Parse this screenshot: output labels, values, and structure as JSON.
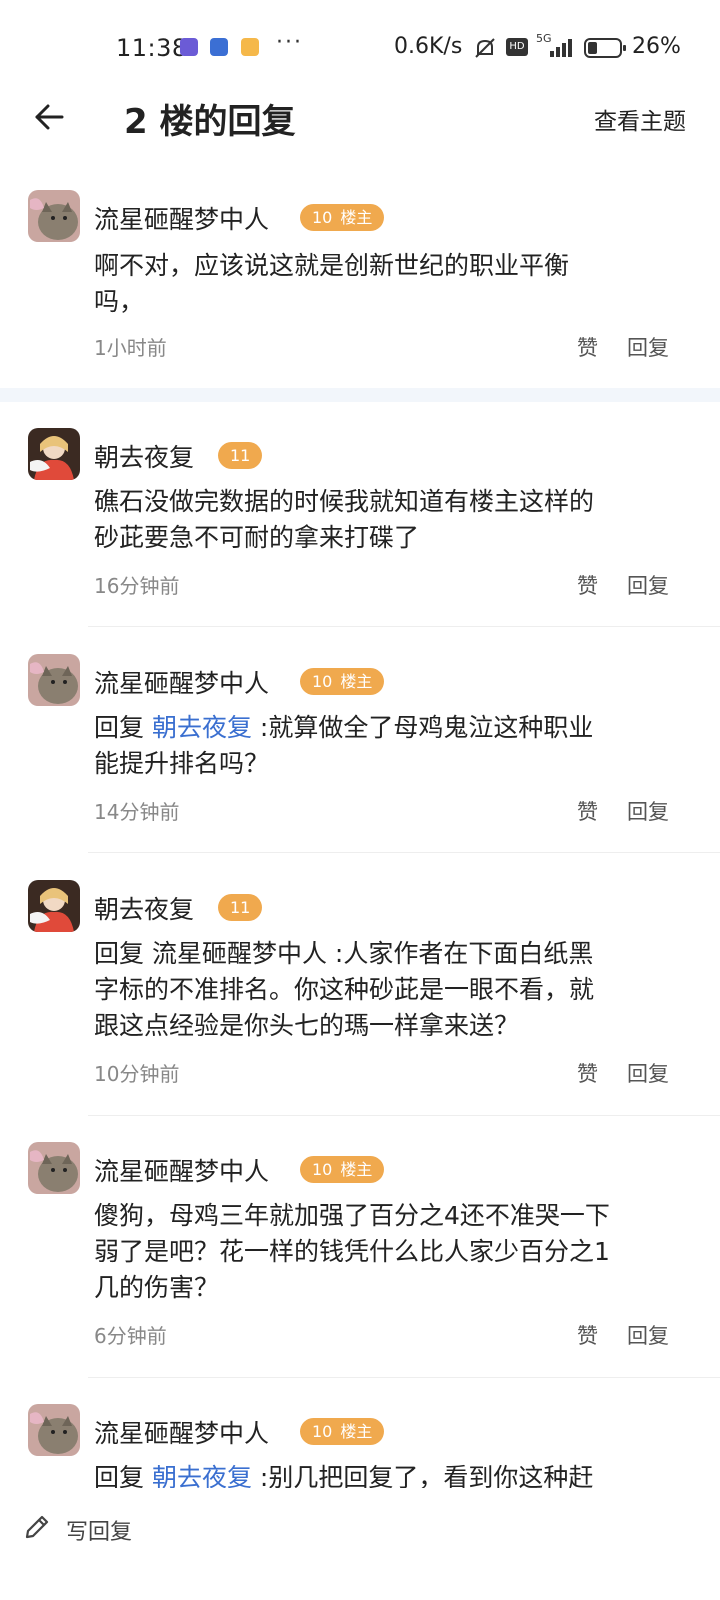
{
  "status_bar": {
    "time": "11:38",
    "dots": "···",
    "net_speed": "0.6K/s",
    "hd": "HD",
    "net_type": "5G",
    "battery": "26%"
  },
  "header": {
    "title": "2 楼的回复",
    "view_topic": "查看主题"
  },
  "comments": [
    {
      "user": "流星砸醒梦中人",
      "level": "10",
      "op_label": "楼主",
      "text_line1": "啊不对，应该说这就是创新世纪的职业平衡",
      "text_line2": "吗，",
      "time": "1小时前",
      "like": "赞",
      "reply": "回复"
    },
    {
      "user": "朝去夜复",
      "level": "11",
      "text_line1": "礁石没做完数据的时候我就知道有楼主这样的",
      "text_line2": "砂茈要急不可耐的拿来打碟了",
      "time": "16分钟前",
      "like": "赞",
      "reply": "回复"
    },
    {
      "user": "流星砸醒梦中人",
      "level": "10",
      "op_label": "楼主",
      "reply_prefix": "回复 ",
      "mention": "朝去夜复",
      "text_line1": " :就算做全了母鸡鬼泣这种职业",
      "text_line2": "能提升排名吗？",
      "time": "14分钟前",
      "like": "赞",
      "reply": "回复"
    },
    {
      "user": "朝去夜复",
      "level": "11",
      "text_line1": "回复 流星砸醒梦中人 :人家作者在下面白纸黑",
      "text_line2": "字标的不准排名。你这种砂茈是一眼不看，就",
      "text_line3": "跟这点经验是你头七的瑪一样拿来送？",
      "time": "10分钟前",
      "like": "赞",
      "reply": "回复"
    },
    {
      "user": "流星砸醒梦中人",
      "level": "10",
      "op_label": "楼主",
      "text_line1": "傻狗，母鸡三年就加强了百分之4还不准哭一下",
      "text_line2": "弱了是吧？花一样的钱凭什么比人家少百分之1",
      "text_line3": "几的伤害？",
      "time": "6分钟前",
      "like": "赞",
      "reply": "回复"
    },
    {
      "user": "流星砸醒梦中人",
      "level": "10",
      "op_label": "楼主",
      "reply_prefix": "回复 ",
      "mention": "朝去夜复",
      "text_line1": " :别几把回复了，看到你这种赶"
    }
  ],
  "bottom_bar": {
    "write_reply": "写回复",
    "icon": "pencil-icon"
  },
  "colors": {
    "badge": "#f0a94e",
    "mention": "#3a6fd0",
    "divider": "#f2f6fb"
  }
}
